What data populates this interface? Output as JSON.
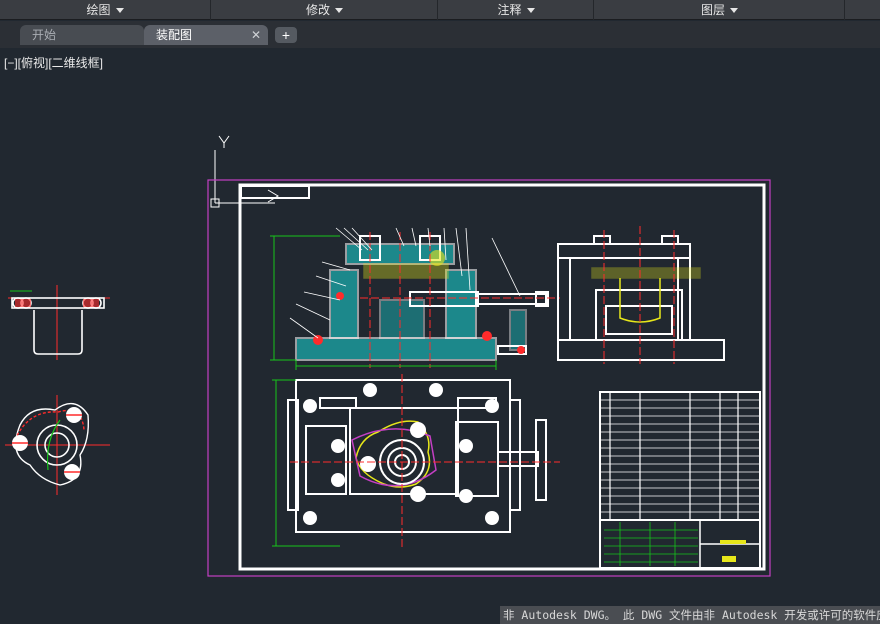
{
  "menu": {
    "items": [
      {
        "label": "绘图"
      },
      {
        "label": "修改"
      },
      {
        "label": "注释"
      },
      {
        "label": "图层"
      }
    ]
  },
  "tabs": {
    "start_label": "开始",
    "drawing_label": "装配图",
    "close_glyph": "✕",
    "add_glyph": "+"
  },
  "viewport": {
    "label": "[−][俯视][二维线框]"
  },
  "ucs": {
    "y_label": "Y"
  },
  "status": {
    "message": "非 Autodesk DWG。 此 DWG 文件由非 Autodesk 开发或许可的软件应用程序保存"
  },
  "colors": {
    "background": "#212830",
    "frame_magenta": "#c43fc4",
    "line_white": "#ffffff",
    "hatch_cyan": "#19d7d7",
    "dim_green": "#16c41a",
    "center_red": "#ff2b2b",
    "yellow": "#e7e71a"
  }
}
